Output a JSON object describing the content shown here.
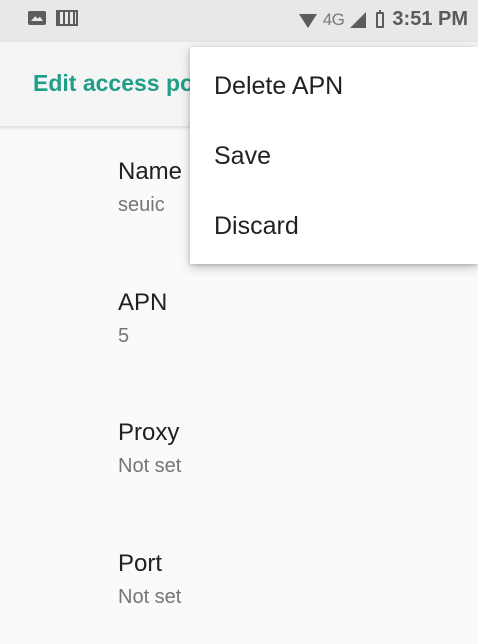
{
  "status_bar": {
    "network": "4G",
    "time": "3:51 PM"
  },
  "app_bar": {
    "title": "Edit access point"
  },
  "preferences": [
    {
      "title": "Name",
      "summary": "seuic"
    },
    {
      "title": "APN",
      "summary": "5"
    },
    {
      "title": "Proxy",
      "summary": "Not set"
    },
    {
      "title": "Port",
      "summary": "Not set"
    }
  ],
  "menu": {
    "items": [
      "Delete APN",
      "Save",
      "Discard"
    ]
  },
  "colors": {
    "accent": "#1f9e8a",
    "status_bar_bg": "#e8e8e8"
  }
}
